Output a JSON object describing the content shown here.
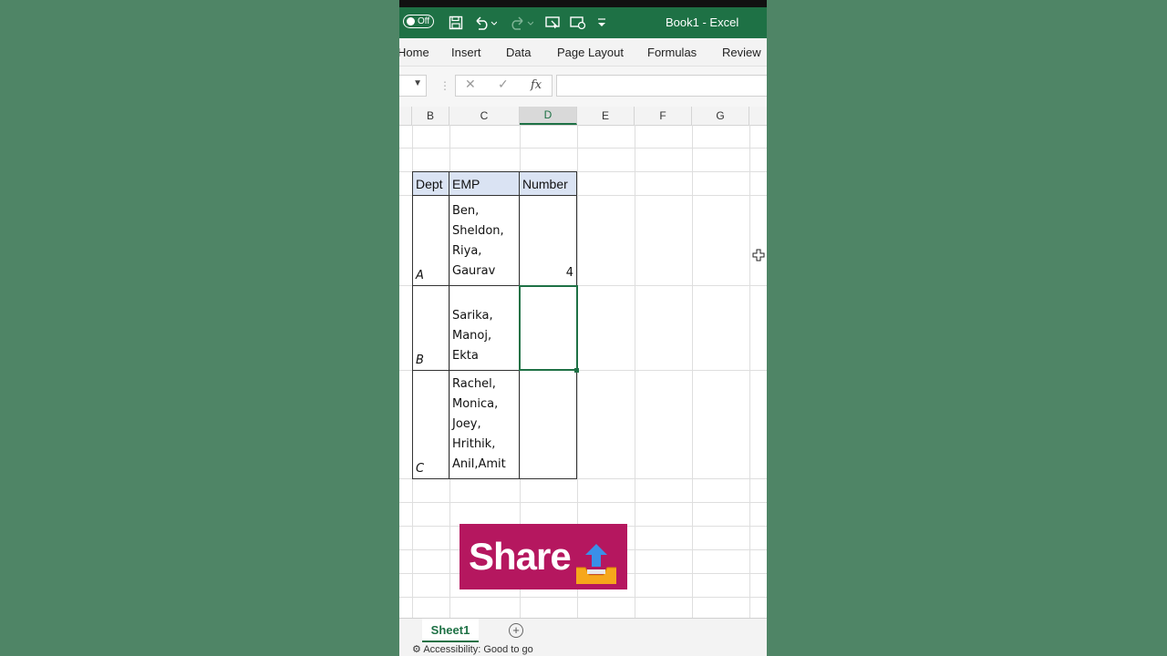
{
  "window": {
    "title": "Book1  -  Excel",
    "autosave_label": "Off"
  },
  "ribbon": {
    "tabs": [
      "Home",
      "Insert",
      "Data",
      "Page Layout",
      "Formulas",
      "Review"
    ]
  },
  "formula_bar": {
    "fx_label": "fx",
    "content": ""
  },
  "columns": [
    "B",
    "C",
    "D",
    "E",
    "F",
    "G"
  ],
  "active_column": "D",
  "table": {
    "headers": [
      "Dept",
      "EMP",
      "Number"
    ],
    "rows": [
      {
        "dept": "A",
        "emp_lines": [
          "Ben,",
          "Sheldon,",
          "Riya,",
          "Gaurav"
        ],
        "number": "4"
      },
      {
        "dept": "B",
        "emp_lines": [
          "Sarika,",
          "Manoj,",
          "Ekta"
        ],
        "number": ""
      },
      {
        "dept": "C",
        "emp_lines": [
          "Rachel,",
          "Monica,",
          "Joey,",
          "Hrithik,",
          "Anil,Amit"
        ],
        "number": ""
      }
    ]
  },
  "overlay": {
    "share_label": "Share",
    "share_color": "#b5175f"
  },
  "sheets": {
    "active": "Sheet1"
  },
  "status": {
    "accessibility": "Accessibility: Good to go"
  },
  "colors": {
    "excel_green": "#1e7145",
    "background": "#4f8566",
    "header_fill": "#dae3f3"
  }
}
